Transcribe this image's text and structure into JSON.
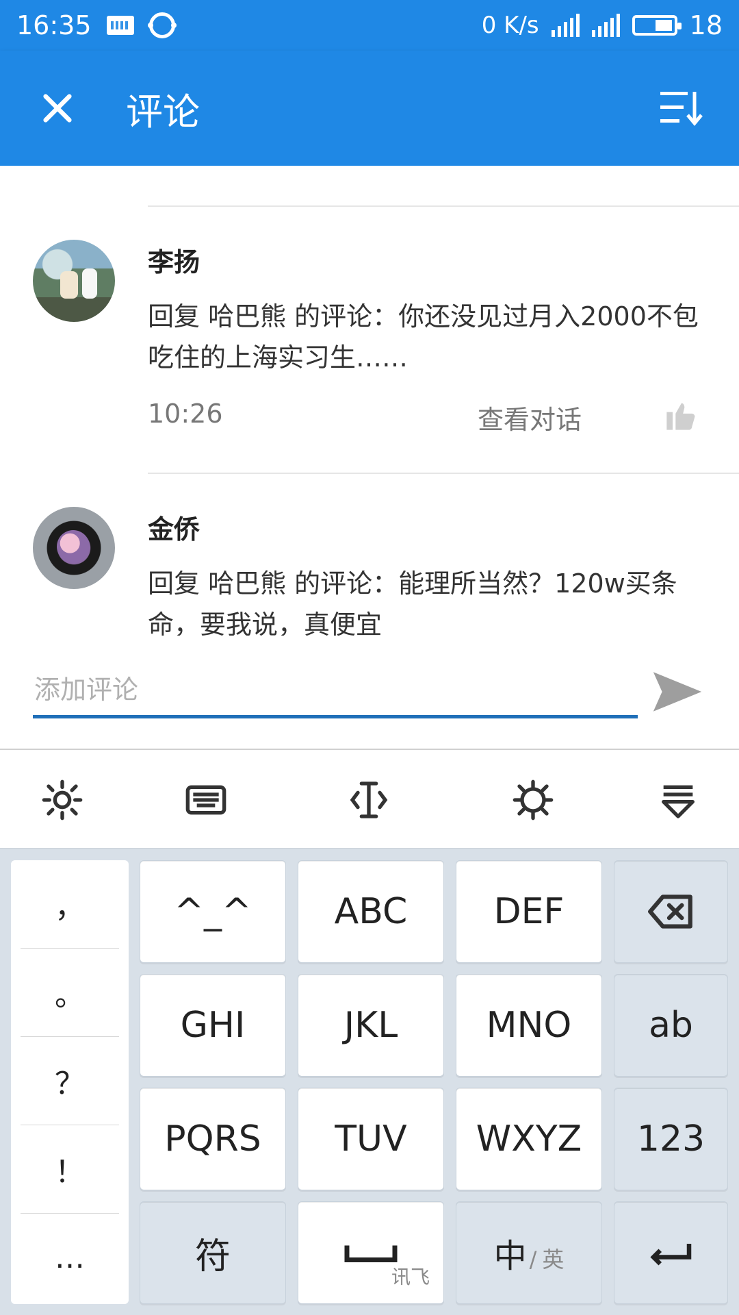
{
  "status_bar": {
    "time": "16:35",
    "network_speed": "0 K/s",
    "battery": "18"
  },
  "app_bar": {
    "title": "评论"
  },
  "comments": [
    {
      "user": "李扬",
      "text": "回复 哈巴熊 的评论：你还没见过月入2000不包吃住的上海实习生……",
      "time": "10:26",
      "action": "查看对话"
    },
    {
      "user": "金侨",
      "text": "回复 哈巴熊 的评论：能理所当然？120w买条命，要我说，真便宜"
    }
  ],
  "input": {
    "placeholder": "添加评论"
  },
  "keyboard": {
    "punctuation": [
      "，",
      "。",
      "？",
      "！",
      "…"
    ],
    "rows": [
      [
        "^_^",
        "ABC",
        "DEF"
      ],
      [
        "GHI",
        "JKL",
        "MNO",
        "ab"
      ],
      [
        "PQRS",
        "TUV",
        "WXYZ",
        "123"
      ],
      [
        "符",
        "讯飞",
        "中",
        "英"
      ]
    ]
  },
  "icons": {
    "close": "close-icon",
    "sort": "sort-icon",
    "send": "send-icon",
    "like": "thumbs-up-icon",
    "settings": "settings-gear-icon",
    "keyboard": "keyboard-icon",
    "cursor": "text-cursor-icon",
    "theme": "theme-gear-icon",
    "hide": "hide-keyboard-icon",
    "backspace": "backspace-icon",
    "enter": "enter-icon"
  },
  "colors": {
    "primary": "#1f88e5",
    "underline": "#1f6fb8",
    "keyboard_bg": "#d8e0e8"
  }
}
